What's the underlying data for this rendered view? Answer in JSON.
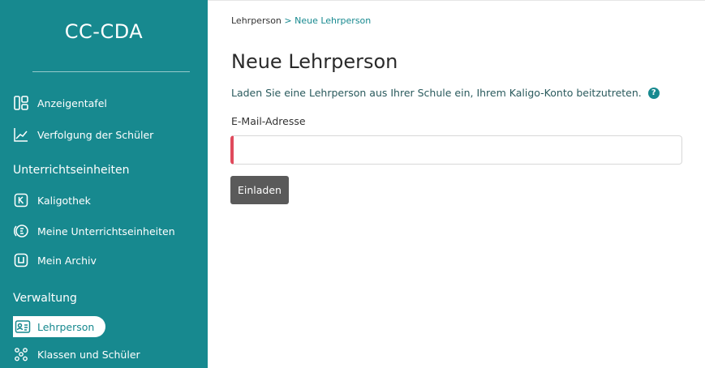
{
  "sidebar": {
    "brand": "CC-CDA",
    "items_top": [
      {
        "label": "Anzeigentafel",
        "icon": "dashboard-icon"
      },
      {
        "label": "Verfolgung der Schüler",
        "icon": "chart-line-icon"
      }
    ],
    "section_units": "Unterrichtseinheiten",
    "items_units": [
      {
        "label": "Kaligothek",
        "icon": "kaligothek-icon"
      },
      {
        "label": "Meine Unterrichtseinheiten",
        "icon": "units-icon"
      },
      {
        "label": "Mein Archiv",
        "icon": "archive-icon"
      }
    ],
    "section_admin": "Verwaltung",
    "items_admin": [
      {
        "label": "Lehrperson",
        "icon": "id-card-icon",
        "active": true
      },
      {
        "label": "Klassen und Schüler",
        "icon": "group-icon"
      }
    ]
  },
  "main": {
    "breadcrumb": {
      "parent": "Lehrperson",
      "separator": " > ",
      "current": "Neue Lehrperson"
    },
    "title": "Neue Lehrperson",
    "lead": "Laden Sie eine Lehrperson aus Ihrer Schule ein, Ihrem Kaligo-Konto beitzutreten.",
    "help": "?",
    "email_label": "E-Mail-Adresse",
    "email_value": "",
    "email_placeholder": "",
    "invite_button": "Einladen"
  },
  "colors": {
    "sidebar": "#17898f",
    "accent": "#17898f",
    "error": "#e04a5c",
    "button": "#5a5a5a"
  }
}
